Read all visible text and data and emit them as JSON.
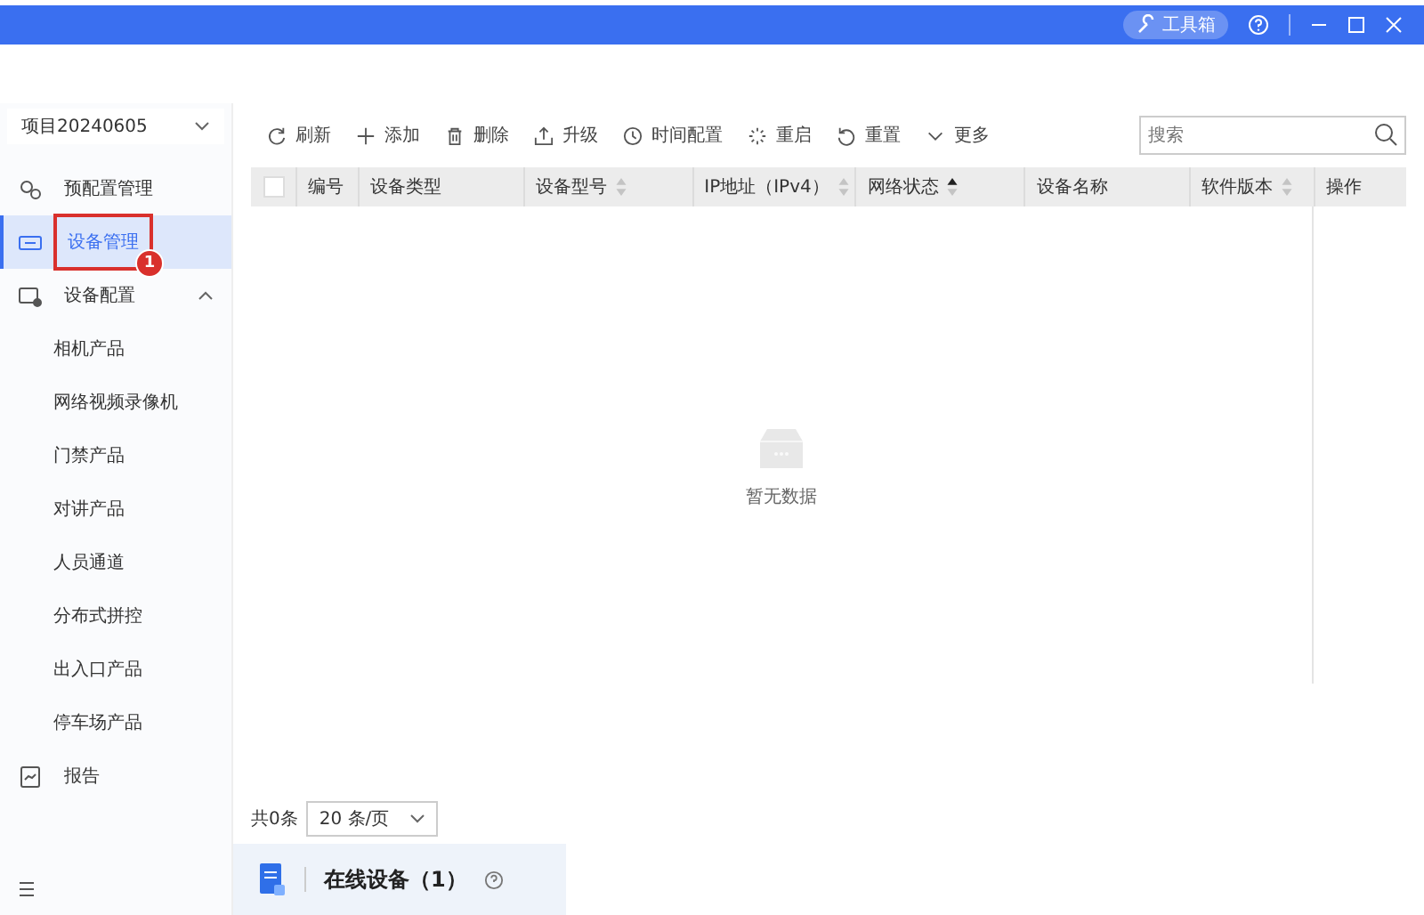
{
  "title_bar": {
    "toolbox": "工具箱"
  },
  "sidebar": {
    "project": "项目20240605",
    "items": [
      {
        "label": "预配置管理",
        "selected": false
      },
      {
        "label": "设备管理",
        "selected": true,
        "annotation": "1"
      },
      {
        "label": "设备配置",
        "selected": false,
        "expanded": true,
        "children": [
          {
            "label": "相机产品",
            "selected": false
          },
          {
            "label": "网络视频录像机",
            "selected": false
          },
          {
            "label": "门禁产品",
            "selected": false
          },
          {
            "label": "对讲产品",
            "selected": false
          },
          {
            "label": "人员通道",
            "selected": false
          },
          {
            "label": "分布式拼控",
            "selected": false
          },
          {
            "label": "出入口产品",
            "selected": false
          },
          {
            "label": "停车场产品",
            "selected": false
          }
        ]
      },
      {
        "label": "报告",
        "selected": false
      }
    ]
  },
  "toolbar": [
    "刷新",
    "添加",
    "删除",
    "升级",
    "时间配置",
    "重启",
    "重置",
    "更多"
  ],
  "search": {
    "placeholder": "搜索"
  },
  "table": {
    "select_all_checked": false,
    "columns": [
      {
        "label": "编号",
        "sortable": false,
        "sorted": false
      },
      {
        "label": "设备类型",
        "sortable": false,
        "sorted": false
      },
      {
        "label": "设备型号",
        "sortable": true,
        "sorted": false
      },
      {
        "label": "IP地址（IPv4）",
        "sortable": true,
        "sorted": false
      },
      {
        "label": "网络状态",
        "sortable": true,
        "sorted": true
      },
      {
        "label": "设备名称",
        "sortable": false,
        "sorted": false
      },
      {
        "label": "软件版本",
        "sortable": true,
        "sorted": false
      },
      {
        "label": "操作",
        "sortable": false,
        "sorted": false
      }
    ],
    "empty_text": "暂无数据"
  },
  "pagination": {
    "total": "共0条",
    "page_size": "20 条/页"
  },
  "online_panel": {
    "label": "在线设备（1）"
  }
}
